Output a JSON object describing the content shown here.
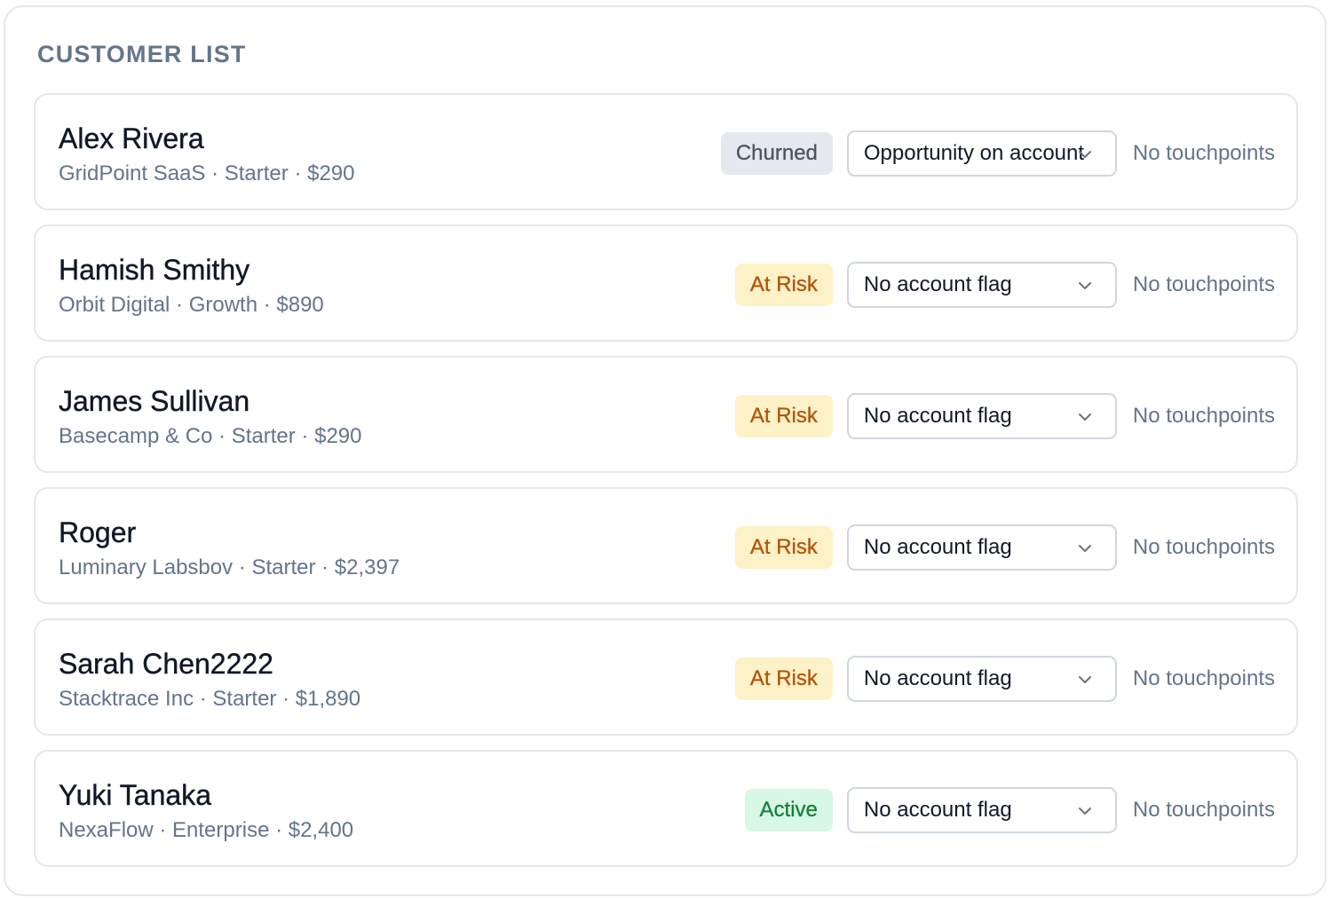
{
  "title": "CUSTOMER LIST",
  "customers": [
    {
      "name": "Alex Rivera",
      "company": "GridPoint SaaS",
      "plan": "Starter",
      "amount": "$290",
      "meta": "GridPoint SaaS · Starter · $290",
      "status": "Churned",
      "status_kind": "churned",
      "flag": "Opportunity on account",
      "touchpoints": "No touchpoints"
    },
    {
      "name": "Hamish Smithy",
      "company": "Orbit Digital",
      "plan": "Growth",
      "amount": "$890",
      "meta": "Orbit Digital · Growth · $890",
      "status": "At Risk",
      "status_kind": "atrisk",
      "flag": "No account flag",
      "touchpoints": "No touchpoints"
    },
    {
      "name": "James Sullivan",
      "company": "Basecamp & Co",
      "plan": "Starter",
      "amount": "$290",
      "meta": "Basecamp & Co · Starter · $290",
      "status": "At Risk",
      "status_kind": "atrisk",
      "flag": "No account flag",
      "touchpoints": "No touchpoints"
    },
    {
      "name": "Roger",
      "company": "Luminary Labsbov",
      "plan": "Starter",
      "amount": "$2,397",
      "meta": "Luminary Labsbov · Starter · $2,397",
      "status": "At Risk",
      "status_kind": "atrisk",
      "flag": "No account flag",
      "touchpoints": "No touchpoints"
    },
    {
      "name": "Sarah Chen2222",
      "company": "Stacktrace Inc",
      "plan": "Starter",
      "amount": "$1,890",
      "meta": "Stacktrace Inc · Starter · $1,890",
      "status": "At Risk",
      "status_kind": "atrisk",
      "flag": "No account flag",
      "touchpoints": "No touchpoints"
    },
    {
      "name": "Yuki Tanaka",
      "company": "NexaFlow",
      "plan": "Enterprise",
      "amount": "$2,400",
      "meta": "NexaFlow · Enterprise · $2,400",
      "status": "Active",
      "status_kind": "active",
      "flag": "No account flag",
      "touchpoints": "No touchpoints"
    }
  ],
  "colors": {
    "churned_bg": "#e5e9ef",
    "churned_text": "#4b5563",
    "atrisk_bg": "#fdf1c7",
    "atrisk_text": "#b45309",
    "active_bg": "#d8f7e4",
    "active_text": "#15803d",
    "muted_text": "#64748b",
    "primary_text": "#111827"
  },
  "icons": {
    "select_chevron": "chevron-down-icon"
  }
}
